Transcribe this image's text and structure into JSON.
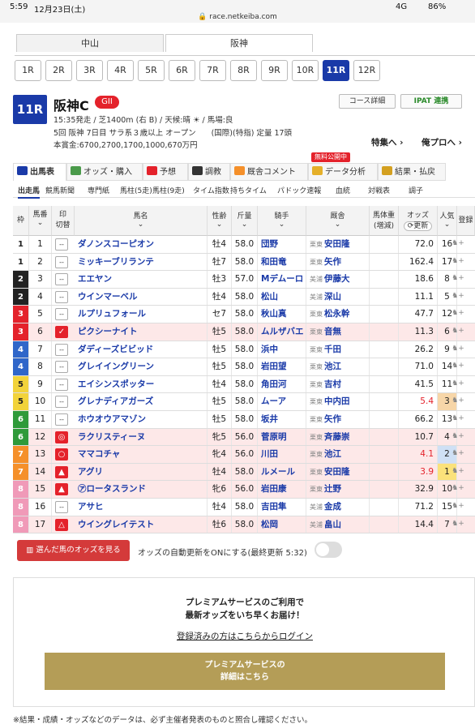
{
  "status": {
    "time": "5:59",
    "date": "12月23日(土)",
    "url": "race.netkeiba.com",
    "signal": "4G",
    "battery": "86%"
  },
  "venues": [
    {
      "label": "中山",
      "active": false
    },
    {
      "label": "阪神",
      "active": true
    }
  ],
  "race_buttons": [
    "1R",
    "2R",
    "3R",
    "4R",
    "5R",
    "6R",
    "7R",
    "8R",
    "9R",
    "10R",
    "11R",
    "12R"
  ],
  "active_race": "11R",
  "race": {
    "number": "11R",
    "name": "阪神C",
    "grade": "GII",
    "line1": "15:35発走 / 芝1400m (右 B) / 天候:晴 ☀ / 馬場:良",
    "line2": "5回 阪神 7日目 サラ系３歳以上 オープン　　(国際)(特指) 定量 17頭",
    "line3": "本賞金:6700,2700,1700,1000,670万円"
  },
  "top_buttons": {
    "course": "コース詳細",
    "ipat": "IPAT 連携"
  },
  "links": {
    "special": "特集へ ›",
    "ore": "俺プロへ ›"
  },
  "free_badge": "無料公開中",
  "tabs": [
    "出馬表",
    "オッズ・購入",
    "予想",
    "調教",
    "厩舎コメント",
    "データ分析",
    "結果・払戻"
  ],
  "subtabs": [
    "出走馬",
    "競馬新聞",
    "専門紙",
    "馬柱(5走)",
    "馬柱(9走)",
    "タイム指数",
    "持ちタイム",
    "パドック速報",
    "血統",
    "対戦表",
    "調子"
  ],
  "headers": {
    "waku": "枠",
    "umaban": "馬番",
    "mark": "印",
    "mark_sub": "切替",
    "horse": "馬名",
    "sex_age": "性齢",
    "weight": "斤量",
    "jockey": "騎手",
    "stable": "厩舎",
    "body": "馬体重",
    "body_sub": "(増減)",
    "odds": "オッズ",
    "odds_sub": "更新",
    "pop": "人気",
    "reg": "登録"
  },
  "colors": {
    "waku1": "#ffffff",
    "waku2": "#222222",
    "waku3": "#e4222b",
    "waku4": "#2f66c9",
    "waku5": "#f2d33a",
    "waku6": "#2f9a3a",
    "waku7": "#f5902a",
    "waku8": "#f09ab8",
    "accent": "#1a3aa8",
    "red": "#e4222b"
  },
  "horses": [
    {
      "waku": "1",
      "num": "1",
      "mark": "--",
      "name": "ダノンスコーピオン",
      "sex": "牡4",
      "wt": "58.0",
      "jockey": "団野",
      "loc": "栗東",
      "trainer": "安田隆",
      "odds": "72.0",
      "pop": "16",
      "sel": false
    },
    {
      "waku": "1",
      "num": "2",
      "mark": "--",
      "name": "ミッキーブリランテ",
      "sex": "牡7",
      "wt": "58.0",
      "jockey": "和田竜",
      "loc": "栗東",
      "trainer": "矢作",
      "odds": "162.4",
      "pop": "17",
      "sel": false
    },
    {
      "waku": "2",
      "num": "3",
      "mark": "--",
      "name": "エエヤン",
      "sex": "牡3",
      "wt": "57.0",
      "jockey": "Mデムーロ",
      "loc": "美浦",
      "trainer": "伊藤大",
      "odds": "18.6",
      "pop": "8",
      "sel": false
    },
    {
      "waku": "2",
      "num": "4",
      "mark": "--",
      "name": "ウインマーベル",
      "sex": "牡4",
      "wt": "58.0",
      "jockey": "松山",
      "loc": "美浦",
      "trainer": "深山",
      "odds": "11.1",
      "pop": "5",
      "sel": false
    },
    {
      "waku": "3",
      "num": "5",
      "mark": "--",
      "name": "ルプリュフォール",
      "sex": "セ7",
      "wt": "58.0",
      "jockey": "秋山真",
      "loc": "栗東",
      "trainer": "松永幹",
      "odds": "47.7",
      "pop": "12",
      "sel": false
    },
    {
      "waku": "3",
      "num": "6",
      "mark": "✓",
      "name": "ピクシーナイト",
      "sex": "牡5",
      "wt": "58.0",
      "jockey": "ムルザバエ",
      "loc": "栗東",
      "trainer": "音無",
      "odds": "11.3",
      "pop": "6",
      "sel": true
    },
    {
      "waku": "4",
      "num": "7",
      "mark": "--",
      "name": "ダディーズビビッド",
      "sex": "牡5",
      "wt": "58.0",
      "jockey": "浜中",
      "loc": "栗東",
      "trainer": "千田",
      "odds": "26.2",
      "pop": "9",
      "sel": false
    },
    {
      "waku": "4",
      "num": "8",
      "mark": "--",
      "name": "グレイイングリーン",
      "sex": "牡5",
      "wt": "58.0",
      "jockey": "岩田望",
      "loc": "栗東",
      "trainer": "池江",
      "odds": "71.0",
      "pop": "14",
      "sel": false
    },
    {
      "waku": "5",
      "num": "9",
      "mark": "--",
      "name": "エイシンスポッター",
      "sex": "牡4",
      "wt": "58.0",
      "jockey": "角田河",
      "loc": "栗東",
      "trainer": "吉村",
      "odds": "41.5",
      "pop": "11",
      "sel": false
    },
    {
      "waku": "5",
      "num": "10",
      "mark": "--",
      "name": "グレナディアガーズ",
      "sex": "牡5",
      "wt": "58.0",
      "jockey": "ムーア",
      "loc": "栗東",
      "trainer": "中内田",
      "odds": "5.4",
      "pop": "3",
      "sel": false
    },
    {
      "waku": "6",
      "num": "11",
      "mark": "--",
      "name": "ホウオウアマゾン",
      "sex": "牡5",
      "wt": "58.0",
      "jockey": "坂井",
      "loc": "栗東",
      "trainer": "矢作",
      "odds": "66.2",
      "pop": "13",
      "sel": false
    },
    {
      "waku": "6",
      "num": "12",
      "mark": "◎",
      "name": "ラクリスティーヌ",
      "sex": "牝5",
      "wt": "56.0",
      "jockey": "菅原明",
      "loc": "栗東",
      "trainer": "斉藤崇",
      "odds": "10.7",
      "pop": "4",
      "sel": true
    },
    {
      "waku": "7",
      "num": "13",
      "mark": "○",
      "name": "ママコチャ",
      "sex": "牝4",
      "wt": "56.0",
      "jockey": "川田",
      "loc": "栗東",
      "trainer": "池江",
      "odds": "4.1",
      "pop": "2",
      "sel": true
    },
    {
      "waku": "7",
      "num": "14",
      "mark": "▲",
      "name": "アグリ",
      "sex": "牡4",
      "wt": "58.0",
      "jockey": "ルメール",
      "loc": "栗東",
      "trainer": "安田隆",
      "odds": "3.9",
      "pop": "1",
      "sel": true
    },
    {
      "waku": "8",
      "num": "15",
      "mark": "▲",
      "name": "㋐ロータスランド",
      "sex": "牝6",
      "wt": "56.0",
      "jockey": "岩田康",
      "loc": "栗東",
      "trainer": "辻野",
      "odds": "32.9",
      "pop": "10",
      "sel": true
    },
    {
      "waku": "8",
      "num": "16",
      "mark": "--",
      "name": "アサヒ",
      "sex": "牡4",
      "wt": "58.0",
      "jockey": "吉田隼",
      "loc": "美浦",
      "trainer": "金成",
      "odds": "71.2",
      "pop": "15",
      "sel": false
    },
    {
      "waku": "8",
      "num": "17",
      "mark": "△",
      "name": "ウイングレイテスト",
      "sex": "牡6",
      "wt": "58.0",
      "jockey": "松岡",
      "loc": "美浦",
      "trainer": "畠山",
      "odds": "14.4",
      "pop": "7",
      "sel": true
    }
  ],
  "buttons": {
    "selected_odds": "選んだ馬のオッズを見る",
    "auto_update": "オッズの自動更新をONにする(最終更新 5:32)"
  },
  "premium": {
    "line1": "プレミアムサービスのご利用で",
    "line2": "最新オッズをいち早くお届け！",
    "login": "登録済みの方はこちらからログイン",
    "cta1": "プレミアムサービスの",
    "cta2": "詳細はこちら"
  },
  "footer": "※結果・成績・オッズなどのデータは、必ず主催者発表のものと照合し確認ください。"
}
